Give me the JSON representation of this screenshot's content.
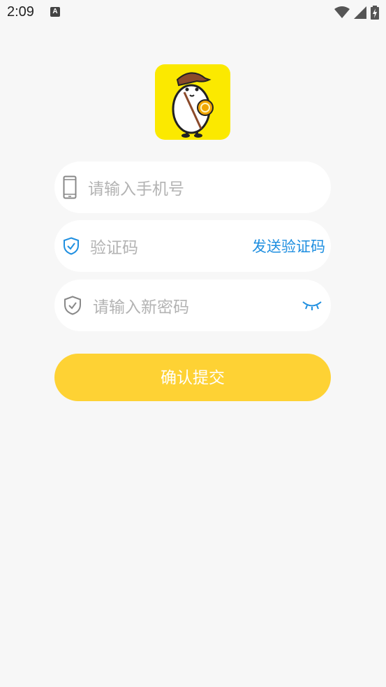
{
  "status": {
    "time": "2:09",
    "notification_glyph": "A"
  },
  "icons": {
    "phone": "phone-icon",
    "shield": "shield-check-icon",
    "eye": "eye-closed-icon",
    "wifi": "wifi-icon",
    "signal": "signal-icon",
    "battery": "battery-charging-icon"
  },
  "colors": {
    "background": "#f7f7f7",
    "logo_bg": "#fbe900",
    "accent_blue": "#1f8fe0",
    "button": "#fed234",
    "placeholder": "#b3b3b3"
  },
  "form": {
    "phone_placeholder": "请输入手机号",
    "code_placeholder": "验证码",
    "send_code_label": "发送验证码",
    "password_placeholder": "请输入新密码",
    "submit_label": "确认提交"
  }
}
